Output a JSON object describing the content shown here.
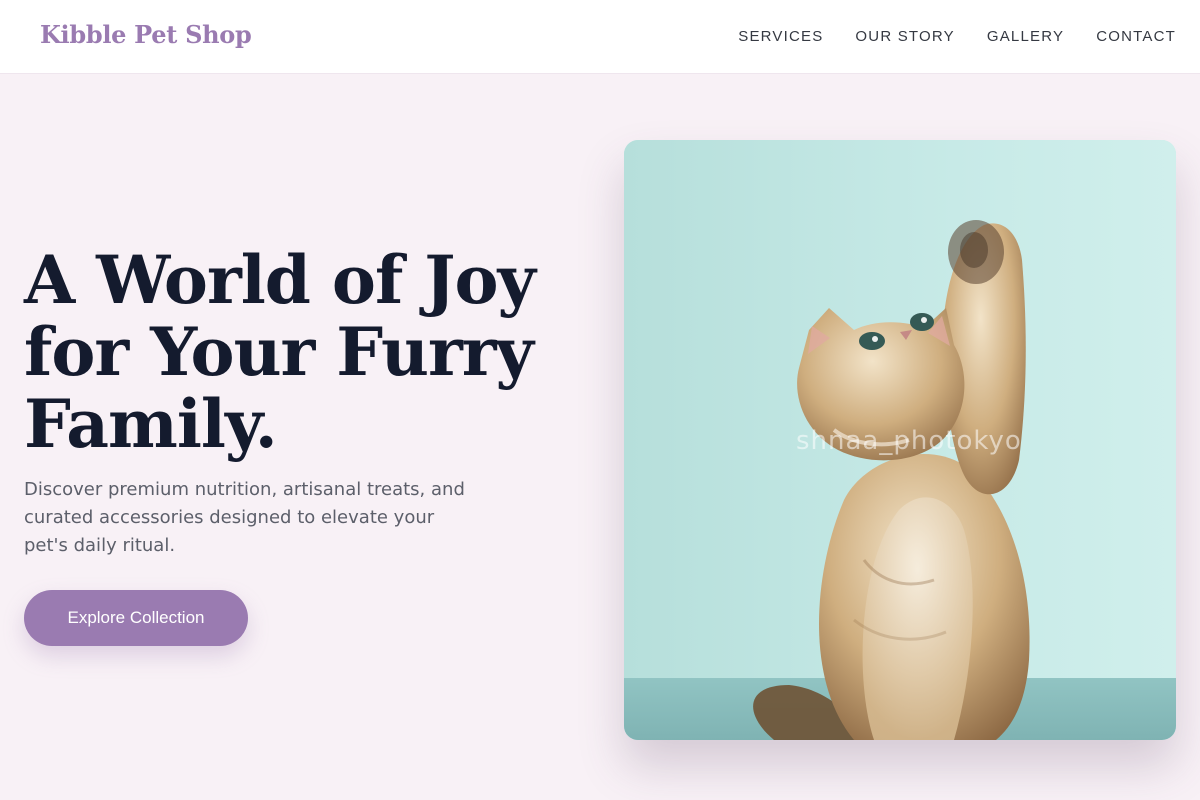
{
  "header": {
    "brand": "Kibble Pet Shop",
    "nav": [
      "SERVICES",
      "OUR STORY",
      "GALLERY",
      "CONTACT"
    ]
  },
  "hero": {
    "title_lines": [
      "A World of Joy",
      "for Your Furry",
      "Family."
    ],
    "description_lines": [
      "Discover premium nutrition, artisanal treats, and",
      "curated accessories designed to elevate your",
      "pet's daily ritual."
    ],
    "cta_label": "Explore Collection",
    "image_watermark": "shnaa_photokyo"
  },
  "colors": {
    "accent": "#9a7bb1",
    "heading": "#141b2e",
    "body_text": "#5c5f6a",
    "page_background": "#f8f1f6",
    "image_background": "#c9ebe8"
  },
  "icons": {
    "photo": "kitten-photo"
  }
}
